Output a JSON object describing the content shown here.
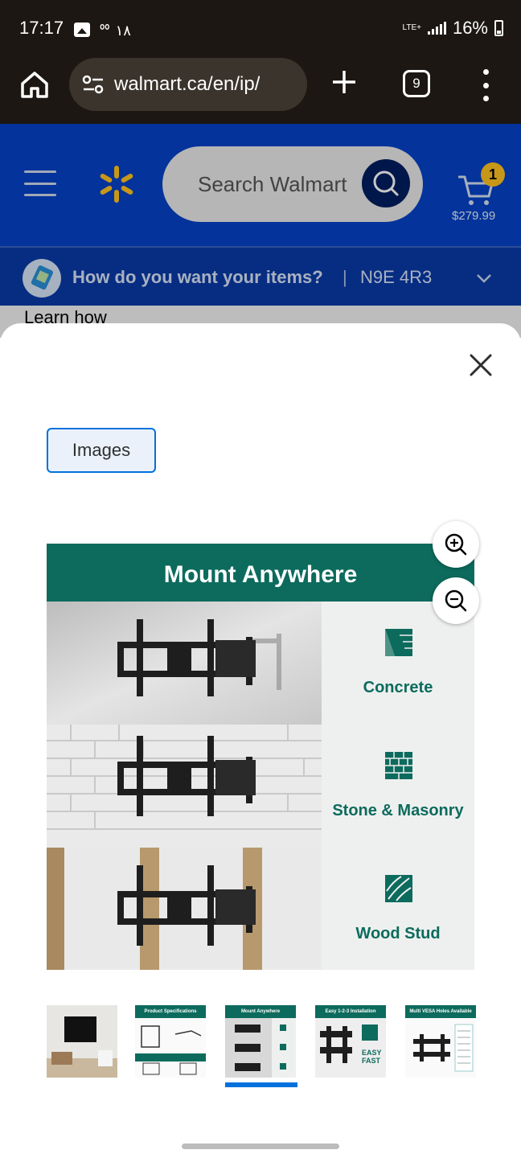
{
  "status_bar": {
    "time": "17:17",
    "extra": "ᅇ ١٨",
    "network": "LTE+",
    "battery": "16%"
  },
  "browser": {
    "url": "walmart.ca/en/ip/",
    "tab_count": "9"
  },
  "walmart_header": {
    "search_placeholder": "Search Walmart",
    "cart_count": "1",
    "cart_total": "$279.99"
  },
  "delivery": {
    "question": "How do you want your items?",
    "separator": "|",
    "postal_code": "N9E 4R3"
  },
  "background_text": {
    "learn_how": "Learn how"
  },
  "modal": {
    "tab_label": "Images",
    "main_image": {
      "title": "Mount Anywhere",
      "rows": [
        {
          "label": "Concrete",
          "icon": "concrete-icon"
        },
        {
          "label": "Stone & Masonry",
          "icon": "brick-icon"
        },
        {
          "label": "Wood Stud",
          "icon": "wood-icon"
        }
      ]
    },
    "thumbnails": [
      {
        "caption": ""
      },
      {
        "caption": "Product Specifications"
      },
      {
        "caption": "Mount Anywhere"
      },
      {
        "caption": "Easy 1-2-3 Installation"
      },
      {
        "caption": "Multi VESA Holes Available"
      }
    ],
    "selected_thumbnail": 3
  },
  "colors": {
    "walmart_blue": "#0542c7",
    "spark_yellow": "#ffc220",
    "teal": "#0c6b5d",
    "selection_blue": "#0071dc"
  }
}
